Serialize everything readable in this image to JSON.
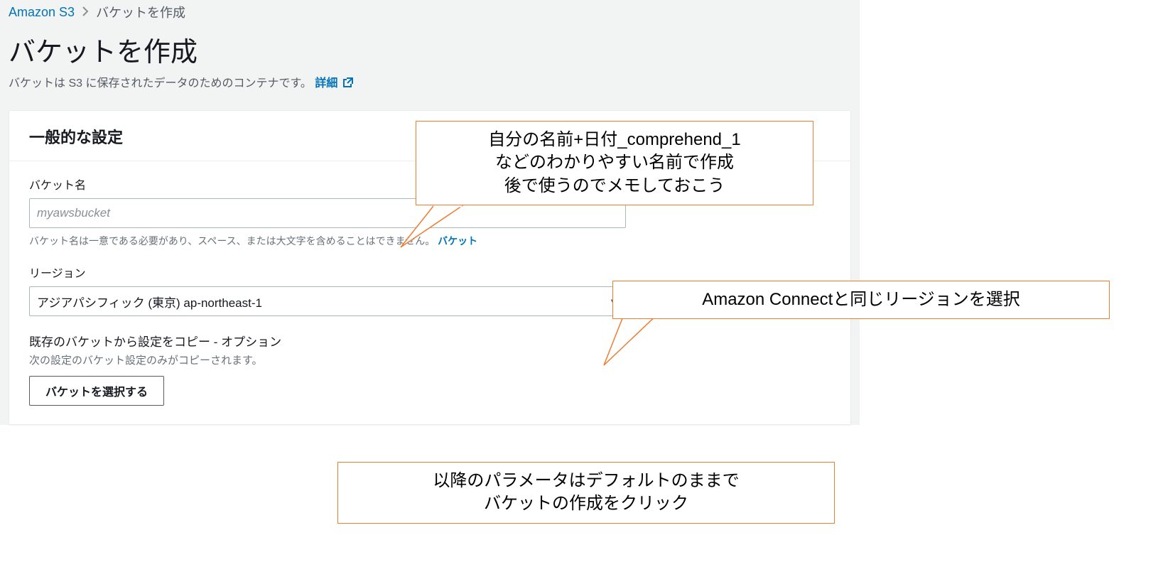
{
  "breadcrumb": {
    "root": "Amazon S3",
    "current": "バケットを作成"
  },
  "page": {
    "title": "バケットを作成",
    "subtitle_prefix": "バケットは S3 に保存されたデータのためのコンテナです。",
    "subtitle_link": "詳細"
  },
  "panel": {
    "title": "一般的な設定"
  },
  "bucket_name": {
    "label": "バケット名",
    "placeholder": "myawsbucket",
    "help_prefix": "バケット名は一意である必要があり、スペース、または大文字を含めることはできません。",
    "help_link": "バケット"
  },
  "region": {
    "label": "リージョン",
    "value": "アジアパシフィック (東京) ap-northeast-1"
  },
  "copy_settings": {
    "title": "既存のバケットから設定をコピー - オプション",
    "desc": "次の設定のバケット設定のみがコピーされます。",
    "button": "バケットを選択する"
  },
  "callouts": {
    "c1_line1": "自分の名前+日付_comprehend_1",
    "c1_line2": "などのわかりやすい名前で作成",
    "c1_line3": "後で使うのでメモしておこう",
    "c2": "Amazon Connectと同じリージョンを選択",
    "c3_line1": "以降のパラメータはデフォルトのままで",
    "c3_line2": "バケットの作成をクリック"
  }
}
